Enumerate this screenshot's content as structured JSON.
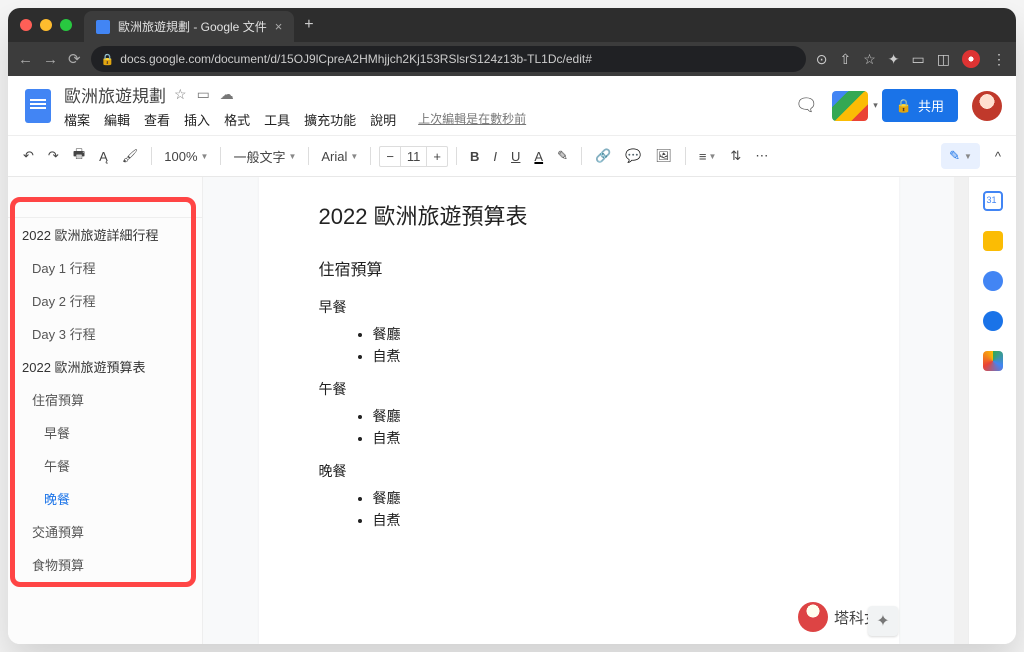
{
  "browser": {
    "tab_title": "歐洲旅遊規劃 - Google 文件",
    "url": "docs.google.com/document/d/15OJ9lCpreA2HMhjjch2Kj153RSlsrS124z13b-TL1Dc/edit#"
  },
  "docs": {
    "title": "歐洲旅遊規劃",
    "last_edit": "上次編輯是在數秒前",
    "share_label": "共用",
    "menu": [
      "檔案",
      "編輯",
      "查看",
      "插入",
      "格式",
      "工具",
      "擴充功能",
      "說明"
    ]
  },
  "toolbar": {
    "zoom": "100%",
    "style": "一般文字",
    "font": "Arial",
    "font_size": "11"
  },
  "outline": {
    "items": [
      {
        "label": "2022 歐洲旅遊詳細行程",
        "lvl": 1
      },
      {
        "label": "Day 1 行程",
        "lvl": 2
      },
      {
        "label": "Day 2 行程",
        "lvl": 2
      },
      {
        "label": "Day 3 行程",
        "lvl": 2
      },
      {
        "label": "2022 歐洲旅遊預算表",
        "lvl": 1
      },
      {
        "label": "住宿預算",
        "lvl": 2
      },
      {
        "label": "早餐",
        "lvl": 3
      },
      {
        "label": "午餐",
        "lvl": 3
      },
      {
        "label": "晚餐",
        "lvl": 3,
        "active": true
      },
      {
        "label": "交通預算",
        "lvl": 2
      },
      {
        "label": "食物預算",
        "lvl": 2
      }
    ]
  },
  "document": {
    "h1": "2022 歐洲旅遊預算表",
    "sections": [
      {
        "h2": "住宿預算"
      }
    ],
    "meals": [
      {
        "name": "早餐",
        "bullets": [
          "餐廳",
          "自煮"
        ]
      },
      {
        "name": "午餐",
        "bullets": [
          "餐廳",
          "自煮"
        ]
      },
      {
        "name": "晚餐",
        "bullets": [
          "餐廳",
          "自煮"
        ]
      }
    ]
  },
  "watermark": "塔科女子"
}
